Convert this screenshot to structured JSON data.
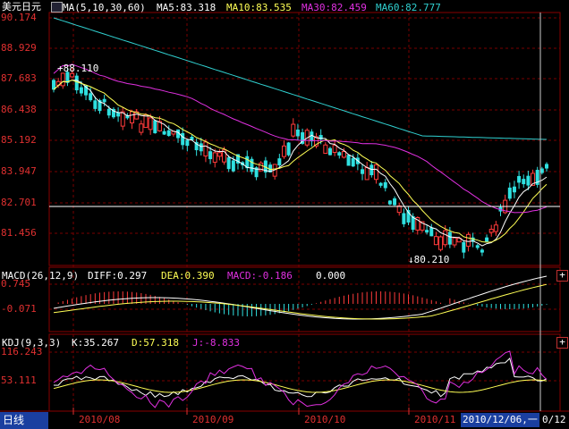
{
  "main_panel": {
    "title": "美元日元",
    "ma_header": "MA(5,10,30,60)",
    "ma5": "MA5:83.318",
    "ma10": "MA10:83.535",
    "ma30": "MA30:82.459",
    "ma60": "MA60:82.777",
    "y_ticks": [
      "90.174",
      "88.929",
      "87.683",
      "86.438",
      "85.192",
      "83.947",
      "82.701",
      "81.456"
    ],
    "high_label": "88.110",
    "low_label": "80.210"
  },
  "macd_panel": {
    "header": "MACD(26,12,9)",
    "diff": "DIFF:0.297",
    "dea": "DEA:0.390",
    "macd": "MACD:-0.186",
    "extra": "0.000",
    "y_ticks": [
      "0.745",
      "-0.071"
    ],
    "expand_glyph": "+"
  },
  "kdj_panel": {
    "header": "KDJ(9,3,3)",
    "k": "K:35.267",
    "d": "D:57.318",
    "j": "J:-8.833",
    "y_ticks": [
      "116.243",
      "53.111"
    ],
    "expand_glyph": "+"
  },
  "footer": {
    "period_tab": "日线",
    "x_ticks": [
      "2010/08",
      "2010/09",
      "2010/10",
      "2010/11"
    ],
    "cursor_date": "2010/12/06,一",
    "last_tick": "0/12"
  },
  "colors": {
    "background": "#000000",
    "grid": "#7a0000",
    "up": "#ff3b3b",
    "down": "#2fe0e0",
    "ma5": "#ffffff",
    "ma10": "#ffff55",
    "ma30": "#e030e0",
    "ma60": "#30d0d0"
  }
}
